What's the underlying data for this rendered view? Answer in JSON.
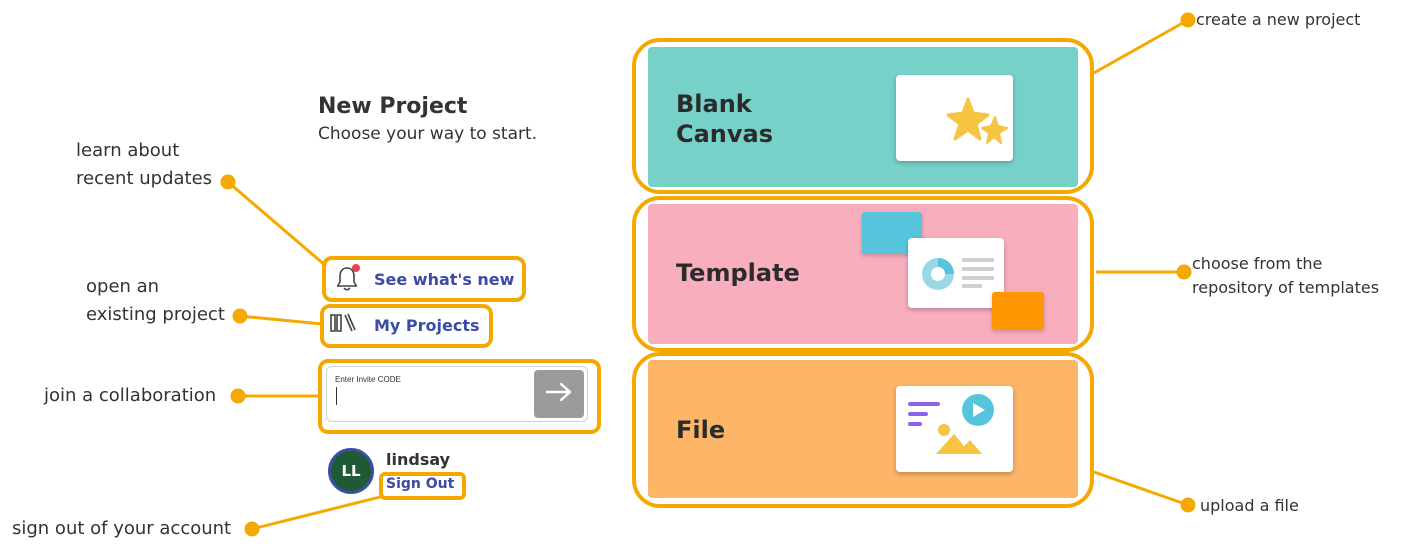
{
  "header": {
    "title": "New Project",
    "subtitle": "Choose your way to start."
  },
  "menu": {
    "whats_new": "See what's new",
    "my_projects": "My Projects"
  },
  "invite": {
    "label": "Enter Invite CODE",
    "value": ""
  },
  "user": {
    "initials": "LL",
    "name": "lindsay",
    "sign_out": "Sign Out"
  },
  "cards": {
    "blank": {
      "line1": "Blank",
      "line2": "Canvas",
      "color": "#76D1C9"
    },
    "template": {
      "label": "Template",
      "color": "#F9AEBE"
    },
    "file": {
      "label": "File",
      "color": "#FDB567"
    }
  },
  "annotations": {
    "learn_1": "learn about",
    "learn_2": "recent updates",
    "open_1": "open an",
    "open_2": "existing project",
    "join": "join a collaboration",
    "signout": "sign out of your account",
    "create": "create a new project",
    "choose_1": "choose from the",
    "choose_2": "repository of templates",
    "upload": "upload a file"
  },
  "colors": {
    "highlight": "#F5A800",
    "accent_text": "#3c4aa8",
    "avatar_bg": "#1f5a34"
  }
}
